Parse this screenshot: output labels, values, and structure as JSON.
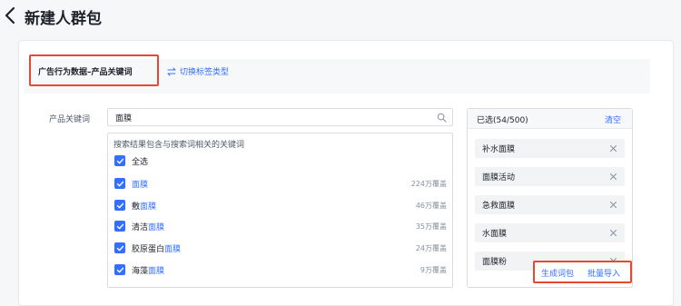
{
  "header": {
    "back_icon": "chevron-left-icon",
    "title": "新建人群包"
  },
  "tag_section": {
    "title": "广告行为数据–产品关键词",
    "switch_icon": "swap-arrows-icon",
    "switch_label": "切换标签类型"
  },
  "keyword_field": {
    "label": "产品关键词",
    "search_value": "面膜",
    "search_icon": "search-icon"
  },
  "results": {
    "hint": "搜索结果包含与搜索词相关的关键词",
    "select_all_label": "全选",
    "select_all_checked": true,
    "items": [
      {
        "prefix": "",
        "match": "面膜",
        "count": "224万覆盖",
        "checked": true
      },
      {
        "prefix": "敷",
        "match": "面膜",
        "count": "46万覆盖",
        "checked": true
      },
      {
        "prefix": "清洁",
        "match": "面膜",
        "count": "35万覆盖",
        "checked": true
      },
      {
        "prefix": "胶原蛋白",
        "match": "面膜",
        "count": "24万覆盖",
        "checked": true
      },
      {
        "prefix": "海藻",
        "match": "面膜",
        "count": "9万覆盖",
        "checked": true
      }
    ]
  },
  "selected": {
    "count_label": "已选(54/500)",
    "clear_label": "清空",
    "remove_icon": "close-icon",
    "items": [
      {
        "label": "补水面膜"
      },
      {
        "label": "面膜活动"
      },
      {
        "label": "急救面膜"
      },
      {
        "label": "水面膜"
      },
      {
        "label": "面膜粉"
      }
    ]
  },
  "actions": {
    "generate_label": "生成词包",
    "import_label": "批量导入"
  },
  "colors": {
    "accent": "#3370ff",
    "highlight_border": "#e8482f",
    "text_primary": "#1f2329",
    "text_secondary": "#86909c"
  }
}
